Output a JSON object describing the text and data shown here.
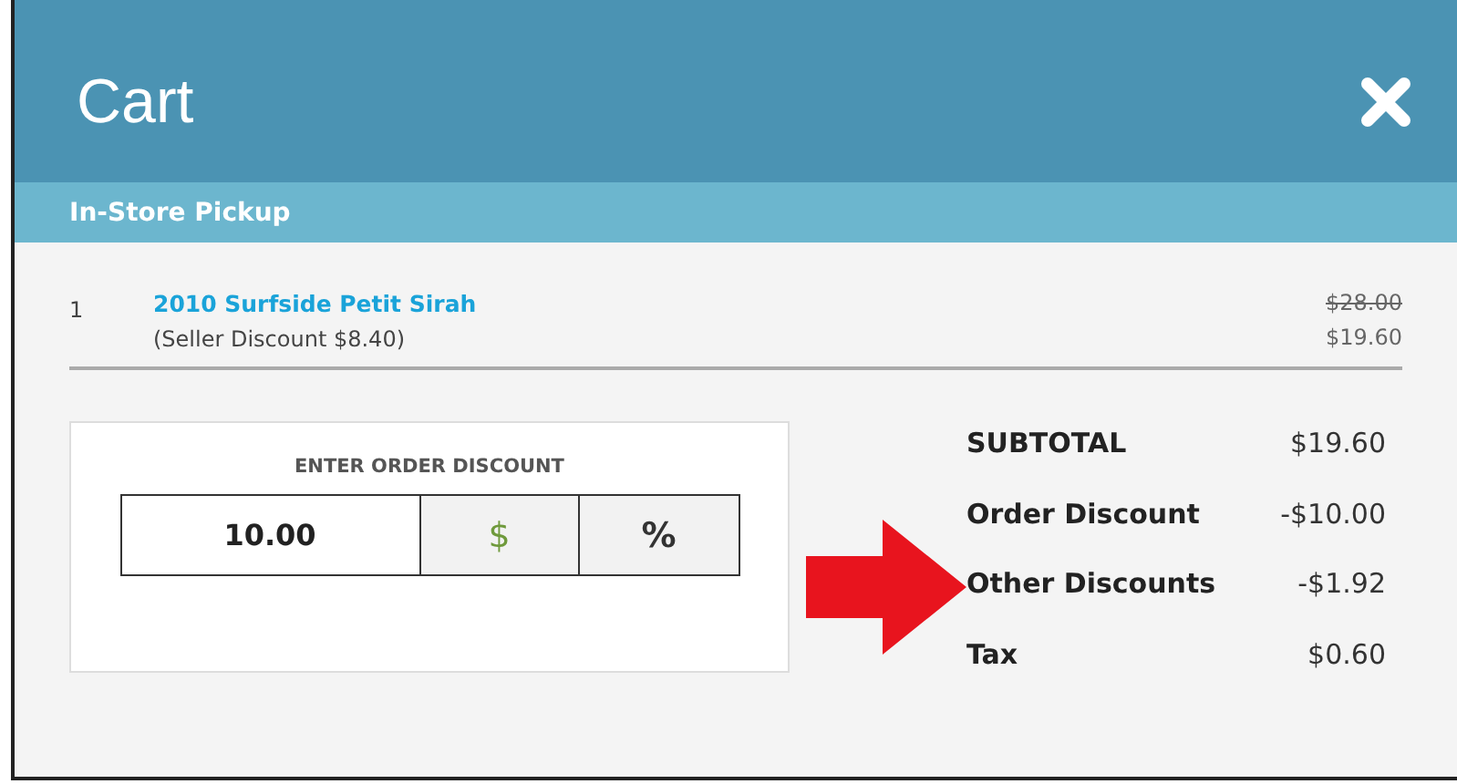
{
  "window": {
    "title": "Cart"
  },
  "section": {
    "title": "In-Store Pickup"
  },
  "items": [
    {
      "quantity": "1",
      "name": "2010 Surfside Petit Sirah",
      "note": "(Seller Discount $8.40)",
      "original_price": "$28.00",
      "price": "$19.60"
    }
  ],
  "discount": {
    "label": "ENTER ORDER DISCOUNT",
    "value": "10.00",
    "units": [
      {
        "label": "$",
        "selected": true
      },
      {
        "label": "%",
        "selected": false
      }
    ]
  },
  "totals": [
    {
      "label": "SUBTOTAL",
      "value": "$19.60"
    },
    {
      "label": "Order Discount",
      "value": "-$10.00"
    },
    {
      "label": "Other Discounts",
      "value": "-$1.92"
    },
    {
      "label": "Tax",
      "value": "$0.60"
    }
  ]
}
